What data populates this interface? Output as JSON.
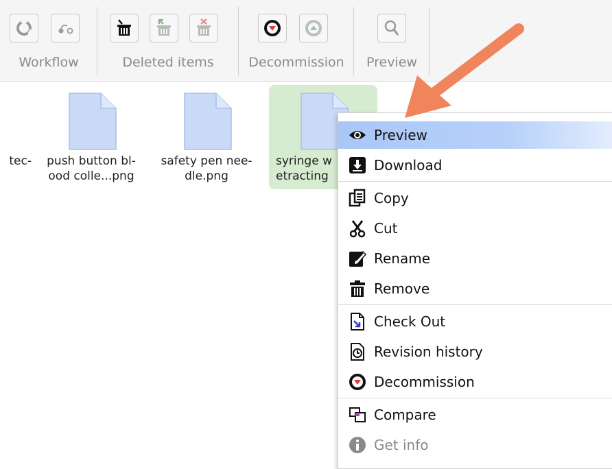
{
  "toolbar": {
    "groups": [
      {
        "label": "Workflow",
        "buttons": [
          "workflow-cycle-icon",
          "workflow-path-icon"
        ]
      },
      {
        "label": "Deleted items",
        "buttons": [
          "trash-icon",
          "restore-icon",
          "delete-forever-icon"
        ]
      },
      {
        "label": "Decommission",
        "buttons": [
          "decommission-icon",
          "recommission-icon"
        ]
      },
      {
        "label": "Preview",
        "buttons": [
          "magnifier-icon"
        ]
      }
    ]
  },
  "files": [
    {
      "line1": "tec-",
      "line2": ""
    },
    {
      "line1": "push button bl-",
      "line2": "ood colle...png"
    },
    {
      "line1": "safety pen nee-",
      "line2": "dle.png"
    },
    {
      "line1": "syringe w",
      "line2": "etracting",
      "selected": true
    }
  ],
  "context_menu": {
    "items": [
      {
        "label": "Preview",
        "icon": "eye-icon",
        "highlighted": true
      },
      {
        "label": "Download",
        "icon": "download-icon"
      },
      {
        "label": "Copy",
        "icon": "copy-icon"
      },
      {
        "label": "Cut",
        "icon": "scissors-icon"
      },
      {
        "label": "Rename",
        "icon": "edit-icon"
      },
      {
        "label": "Remove",
        "icon": "trash-icon"
      },
      {
        "label": "Check Out",
        "icon": "checkout-icon"
      },
      {
        "label": "Revision history",
        "icon": "history-icon"
      },
      {
        "label": "Decommission",
        "icon": "decommission-icon"
      },
      {
        "label": "Compare",
        "icon": "compare-icon"
      },
      {
        "label": "Get info",
        "icon": "info-icon",
        "disabled": true
      }
    ]
  },
  "colors": {
    "highlight": "#a8c6f7",
    "selected_file": "#d6ecd1",
    "arrow": "#f0845a",
    "doc_fill": "#c9daf6"
  }
}
